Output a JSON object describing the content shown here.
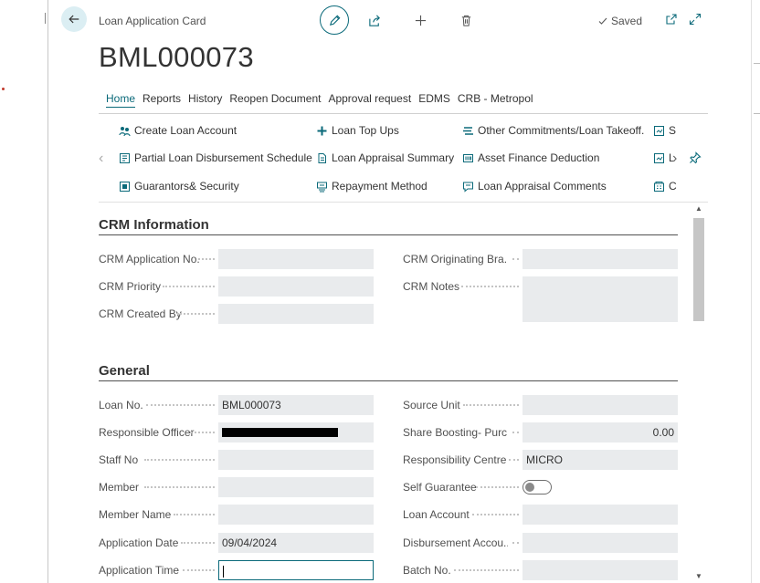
{
  "header": {
    "caption": "Loan Application Card",
    "title": "BML000073",
    "saved_label": "Saved"
  },
  "tabs": [
    "Home",
    "Reports",
    "History",
    "Reopen Document",
    "Approval request",
    "EDMS",
    "CRB - Metropol"
  ],
  "actions": {
    "create_loan_account": "Create Loan Account",
    "loan_top_ups": "Loan Top Ups",
    "other_commitments": "Other Commitments/Loan Takeoff.",
    "col4_row1": "S",
    "partial_disbursement": "Partial Loan Disbursement Schedule",
    "appraisal_summary": "Loan Appraisal Summary",
    "asset_finance": "Asset Finance Deduction",
    "col4_row2": "L",
    "guarantors": "Guarantors& Security",
    "repayment_method": "Repayment Method",
    "appraisal_comments": "Loan Appraisal Comments",
    "col4_row3": "C"
  },
  "crm": {
    "section_title": "CRM Information",
    "application_no_label": "CRM Application No.",
    "application_no_value": "",
    "priority_label": "CRM Priority",
    "priority_value": "",
    "created_by_label": "CRM Created By",
    "created_by_value": "",
    "originating_branch_label": "CRM Originating Bra...",
    "originating_branch_value": "",
    "notes_label": "CRM Notes",
    "notes_value": ""
  },
  "general": {
    "section_title": "General",
    "loan_no_label": "Loan No.",
    "loan_no_value": "BML000073",
    "responsible_officer_label": "Responsible Officer",
    "staff_no_label": "Staff No",
    "staff_no_value": "",
    "member_label": "Member",
    "member_value": "",
    "member_name_label": "Member Name",
    "member_name_value": "",
    "application_date_label": "Application Date",
    "application_date_value": "09/04/2024",
    "application_time_label": "Application Time",
    "application_time_value": "",
    "source_unit_label": "Source Unit",
    "source_unit_value": "",
    "share_boosting_label": "Share Boosting- Purc...",
    "share_boosting_value": "0.00",
    "responsibility_centre_label": "Responsibility Centre",
    "responsibility_centre_value": "MICRO",
    "self_guarantee_label": "Self Guarantee",
    "self_guarantee_value": false,
    "loan_account_label": "Loan Account",
    "loan_account_value": "",
    "disbursement_account_label": "Disbursement Accou...",
    "disbursement_account_value": "",
    "batch_no_label": "Batch No.",
    "batch_no_value": ""
  },
  "colors": {
    "accent": "#0b6a7a",
    "field_bg": "#e9ebed"
  }
}
